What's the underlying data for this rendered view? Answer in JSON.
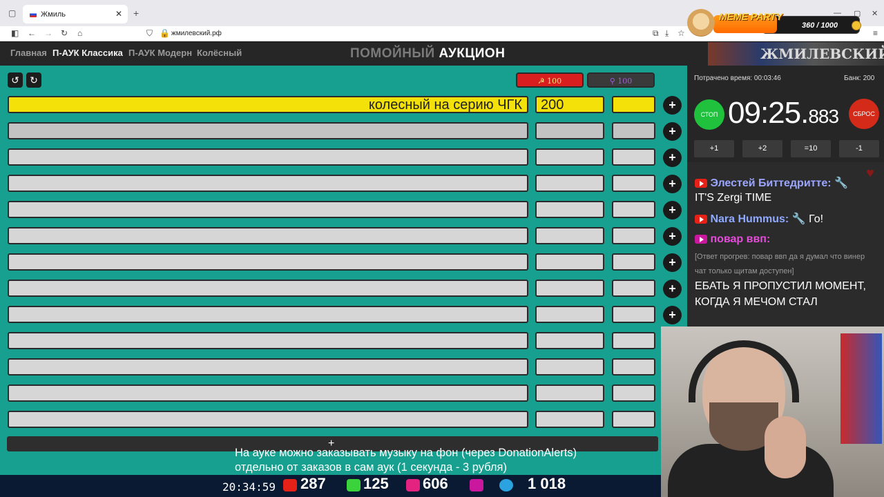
{
  "browser": {
    "tab_title": "Жмиль",
    "url": "жмилевский.рф"
  },
  "overlay": {
    "meme_title": "MEME PARTY",
    "meme_count": "360 / 1000"
  },
  "header": {
    "nav": [
      "Главная",
      "П-АУК Классика",
      "П-АУК Модерн",
      "Колёсный"
    ],
    "title_dim": "ПОМОЙНЫЙ",
    "title_bright": "АУКЦИОН",
    "banner_text": "ЖМИЛЕВСКИЙ.РФ"
  },
  "controls": {
    "undo_icon": "↺",
    "redo_icon": "↻",
    "budget_red": "☭ 100",
    "budget_gray": "⚲ 100"
  },
  "lots": [
    {
      "name": "колесный на серию ЧГК",
      "amount": "200"
    },
    {
      "name": "",
      "amount": ""
    },
    {
      "name": "",
      "amount": ""
    },
    {
      "name": "",
      "amount": ""
    },
    {
      "name": "",
      "amount": ""
    },
    {
      "name": "",
      "amount": ""
    },
    {
      "name": "",
      "amount": ""
    },
    {
      "name": "",
      "amount": ""
    },
    {
      "name": "",
      "amount": ""
    },
    {
      "name": "",
      "amount": ""
    },
    {
      "name": "",
      "amount": ""
    },
    {
      "name": "",
      "amount": ""
    },
    {
      "name": "",
      "amount": ""
    }
  ],
  "add_label": "+",
  "timer_panel": {
    "spent": "Потрачено время: 00:03:46",
    "bank": "Банк: 200",
    "stop": "СТОП",
    "reset": "СБРОС",
    "time_main": "09:25.",
    "time_ms": "883",
    "buttons": [
      "+1",
      "+2",
      "=10",
      "-1"
    ]
  },
  "chat": {
    "m1_user": "Элестей Биттедритте:",
    "m1_text": "IT'S Zergi TIME",
    "m2_user": "Nara Hummus:",
    "m2_text": "Го!",
    "m3_user": "повар ввп:",
    "reply": "[Ответ прогрев: повар ввп да я думал что винер чат только щитам доступен]",
    "big": "ЕБАТЬ Я ПРОПУСТИЛ МОМЕНТ, КОГДА Я МЕЧОМ СТАЛ"
  },
  "bottom": {
    "subtitle_1": "На ауке можно заказывать музыку на фон (через DonationAlerts)",
    "subtitle_2": "отдельно от заказов в сам аук (1 секунда - 3 рубля)",
    "time": "20:34:59",
    "youtube": "287",
    "kick": "125",
    "vk": "606",
    "telegram": "1 018"
  }
}
